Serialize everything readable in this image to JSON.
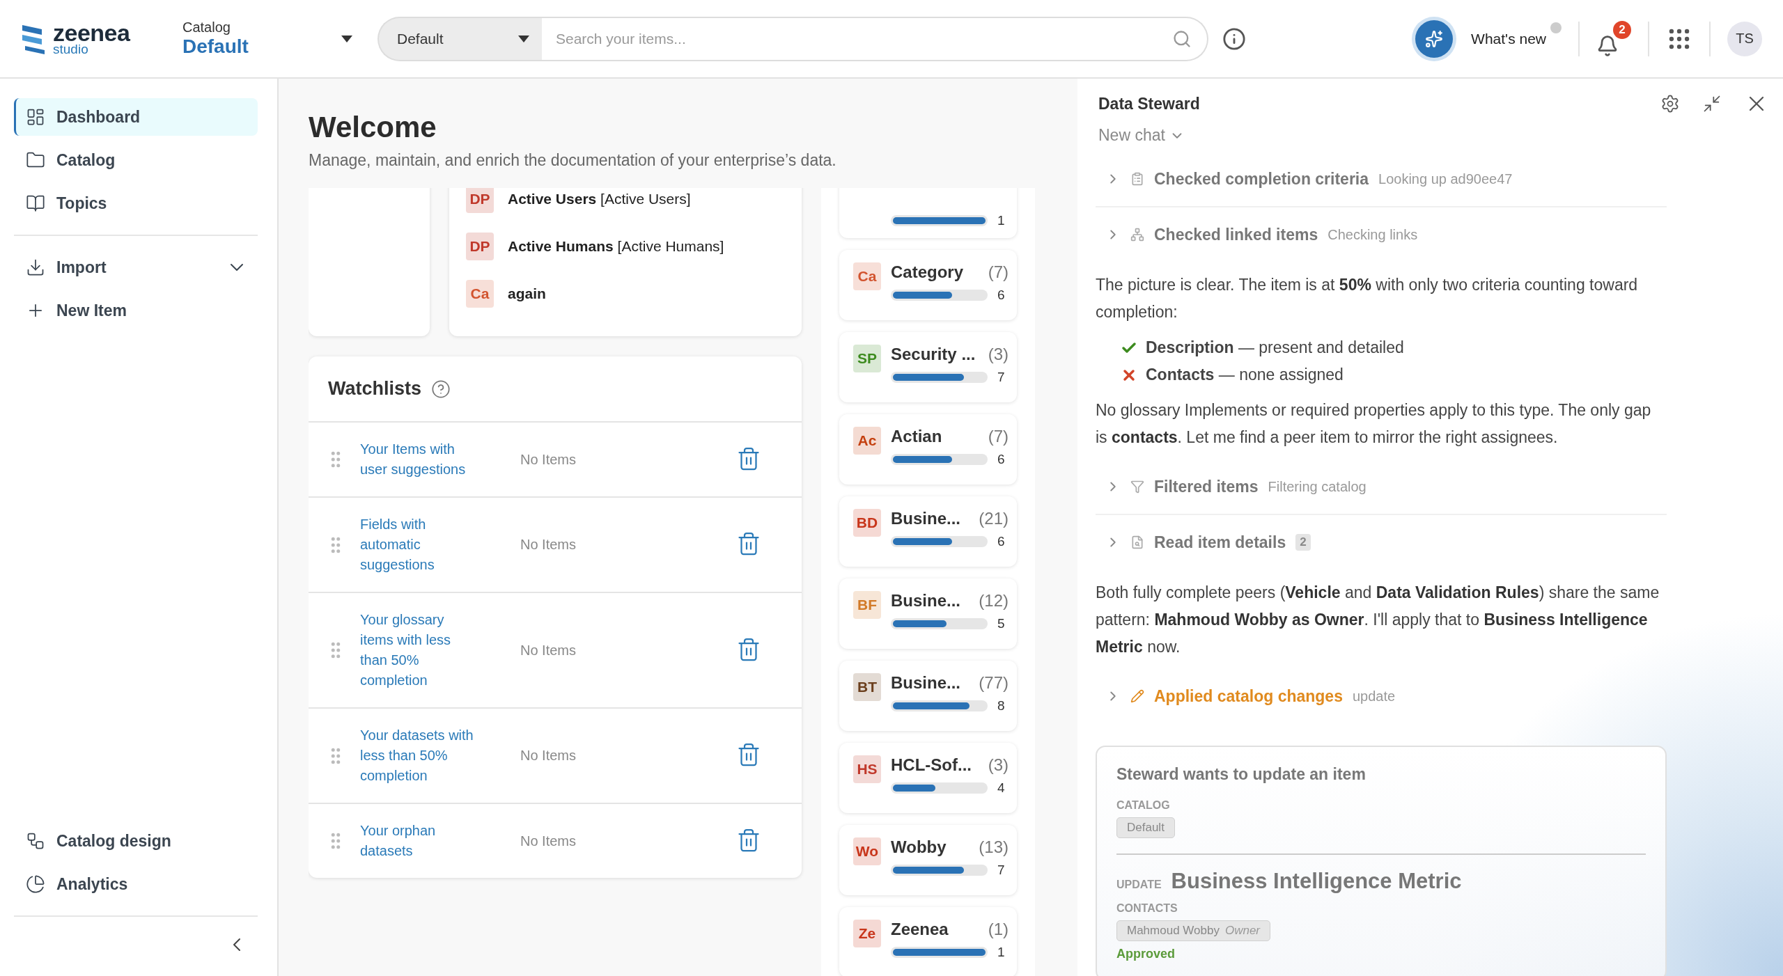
{
  "topbar": {
    "logo": {
      "name": "zeenea",
      "sub": "studio"
    },
    "catalog": {
      "label": "Catalog",
      "value": "Default"
    },
    "search": {
      "scope": "Default",
      "placeholder": "Search your items..."
    },
    "whats_new": "What's new",
    "notifications": "2",
    "avatar": "TS"
  },
  "sidebar": {
    "top": [
      {
        "label": "Dashboard",
        "selected": true
      },
      {
        "label": "Catalog",
        "selected": false
      },
      {
        "label": "Topics",
        "selected": false
      }
    ],
    "actions": [
      {
        "label": "Import",
        "kind": "expandable",
        "expanded": false
      },
      {
        "label": "New Item",
        "kind": "link"
      }
    ],
    "bottom": [
      {
        "label": "Catalog design",
        "selected": false
      },
      {
        "label": "Analytics",
        "selected": false
      }
    ]
  },
  "welcome": {
    "title": "Welcome",
    "subtitle": "Manage, maintain, and enrich the documentation of your enterprise’s data."
  },
  "recent": [
    {
      "badge": "DP",
      "color": "#c0392b",
      "name": "Active Users",
      "detail": "[Active Users]"
    },
    {
      "badge": "DP",
      "color": "#c0392b",
      "name": "Active Humans",
      "detail": "[Active Humans]"
    },
    {
      "badge": "Ca",
      "color": "#d2542f",
      "name": "again"
    }
  ],
  "watchlists": {
    "title": "Watchlists",
    "items": [
      {
        "name": "Your Items with user suggestions",
        "status": "No Items"
      },
      {
        "name": "Fields with automatic suggestions",
        "status": "No Items"
      },
      {
        "name": "Your glossary items with less than 50% completion",
        "status": "No Items"
      },
      {
        "name": "Your datasets with less than 50% completion",
        "status": "No Items"
      },
      {
        "name": "Your orphan datasets",
        "status": "No Items"
      }
    ]
  },
  "types": [
    {
      "level": 1,
      "value": "1"
    },
    {
      "badge": "Ca",
      "color": "#d2542f",
      "name": "Category",
      "count": "(7)",
      "level": 0.64,
      "value": "6"
    },
    {
      "badge": "SP",
      "color": "#3d8b1f",
      "name": "Security ...",
      "count": "(3)",
      "level": 0.77,
      "value": "7"
    },
    {
      "badge": "Ac",
      "color": "#c4400f",
      "name": "Actian",
      "count": "(7)",
      "level": 0.64,
      "value": "6"
    },
    {
      "badge": "BD",
      "color": "#c8361b",
      "name": "Busine...",
      "count": "(21)",
      "level": 0.64,
      "value": "6"
    },
    {
      "badge": "BF",
      "color": "#d27a28",
      "name": "Busine...",
      "count": "(12)",
      "level": 0.58,
      "value": "5"
    },
    {
      "badge": "BT",
      "color": "#6b3f1d",
      "name": "Busine...",
      "count": "(77)",
      "level": 0.83,
      "value": "8"
    },
    {
      "badge": "HS",
      "color": "#c0392b",
      "name": "HCL-Sof...",
      "count": "(3)",
      "level": 0.46,
      "value": "4"
    },
    {
      "badge": "Wo",
      "color": "#c8361b",
      "name": "Wobby",
      "count": "(13)",
      "level": 0.77,
      "value": "7"
    },
    {
      "badge": "Ze",
      "color": "#c8361b",
      "name": "Zeenea",
      "count": "(1)",
      "level": 1,
      "value": "1"
    }
  ],
  "steward": {
    "title": "Data Steward",
    "chat": "New chat",
    "messages": [
      {
        "kind": "step",
        "title": "Checked completion criteria",
        "detail": "Looking up ad90ee47"
      },
      {
        "kind": "step",
        "title": "Checked linked items",
        "detail": "Checking links"
      },
      {
        "kind": "text",
        "text": "The picture is clear. The item is at **50%** with only two criteria counting toward completion:"
      },
      {
        "kind": "checklist",
        "items": [
          {
            "text": "**Description** — present and detailed",
            "ok": true
          },
          {
            "text": "**Contacts** — none assigned",
            "ok": false
          }
        ]
      },
      {
        "kind": "text",
        "text": "No glossary Implements or required properties apply to this type. The only gap is **contacts**. Let me find a peer item to mirror the right assignees."
      },
      {
        "kind": "step",
        "title": "Filtered items",
        "detail": "Filtering catalog"
      },
      {
        "kind": "step",
        "title": "Read item details",
        "count": "2"
      },
      {
        "kind": "text",
        "text": "Both fully complete peers (**Vehicle** and **Data Validation Rules**) share the same pattern: **Mahmoud Wobby as Owner**. I'll apply that to **Business Intelligence Metric** now."
      },
      {
        "kind": "applied",
        "title": "Applied catalog changes",
        "detail": "update"
      }
    ],
    "approval": {
      "title": "Steward wants to update an item",
      "catalog_label": "CATALOG",
      "catalog": "Default",
      "update_label": "UPDATE",
      "item": "Business Intelligence Metric",
      "contacts_label": "CONTACTS",
      "contacts": [
        {
          "name": "Mahmoud Wobby",
          "role": "Owner"
        }
      ],
      "status": "Approved"
    }
  }
}
